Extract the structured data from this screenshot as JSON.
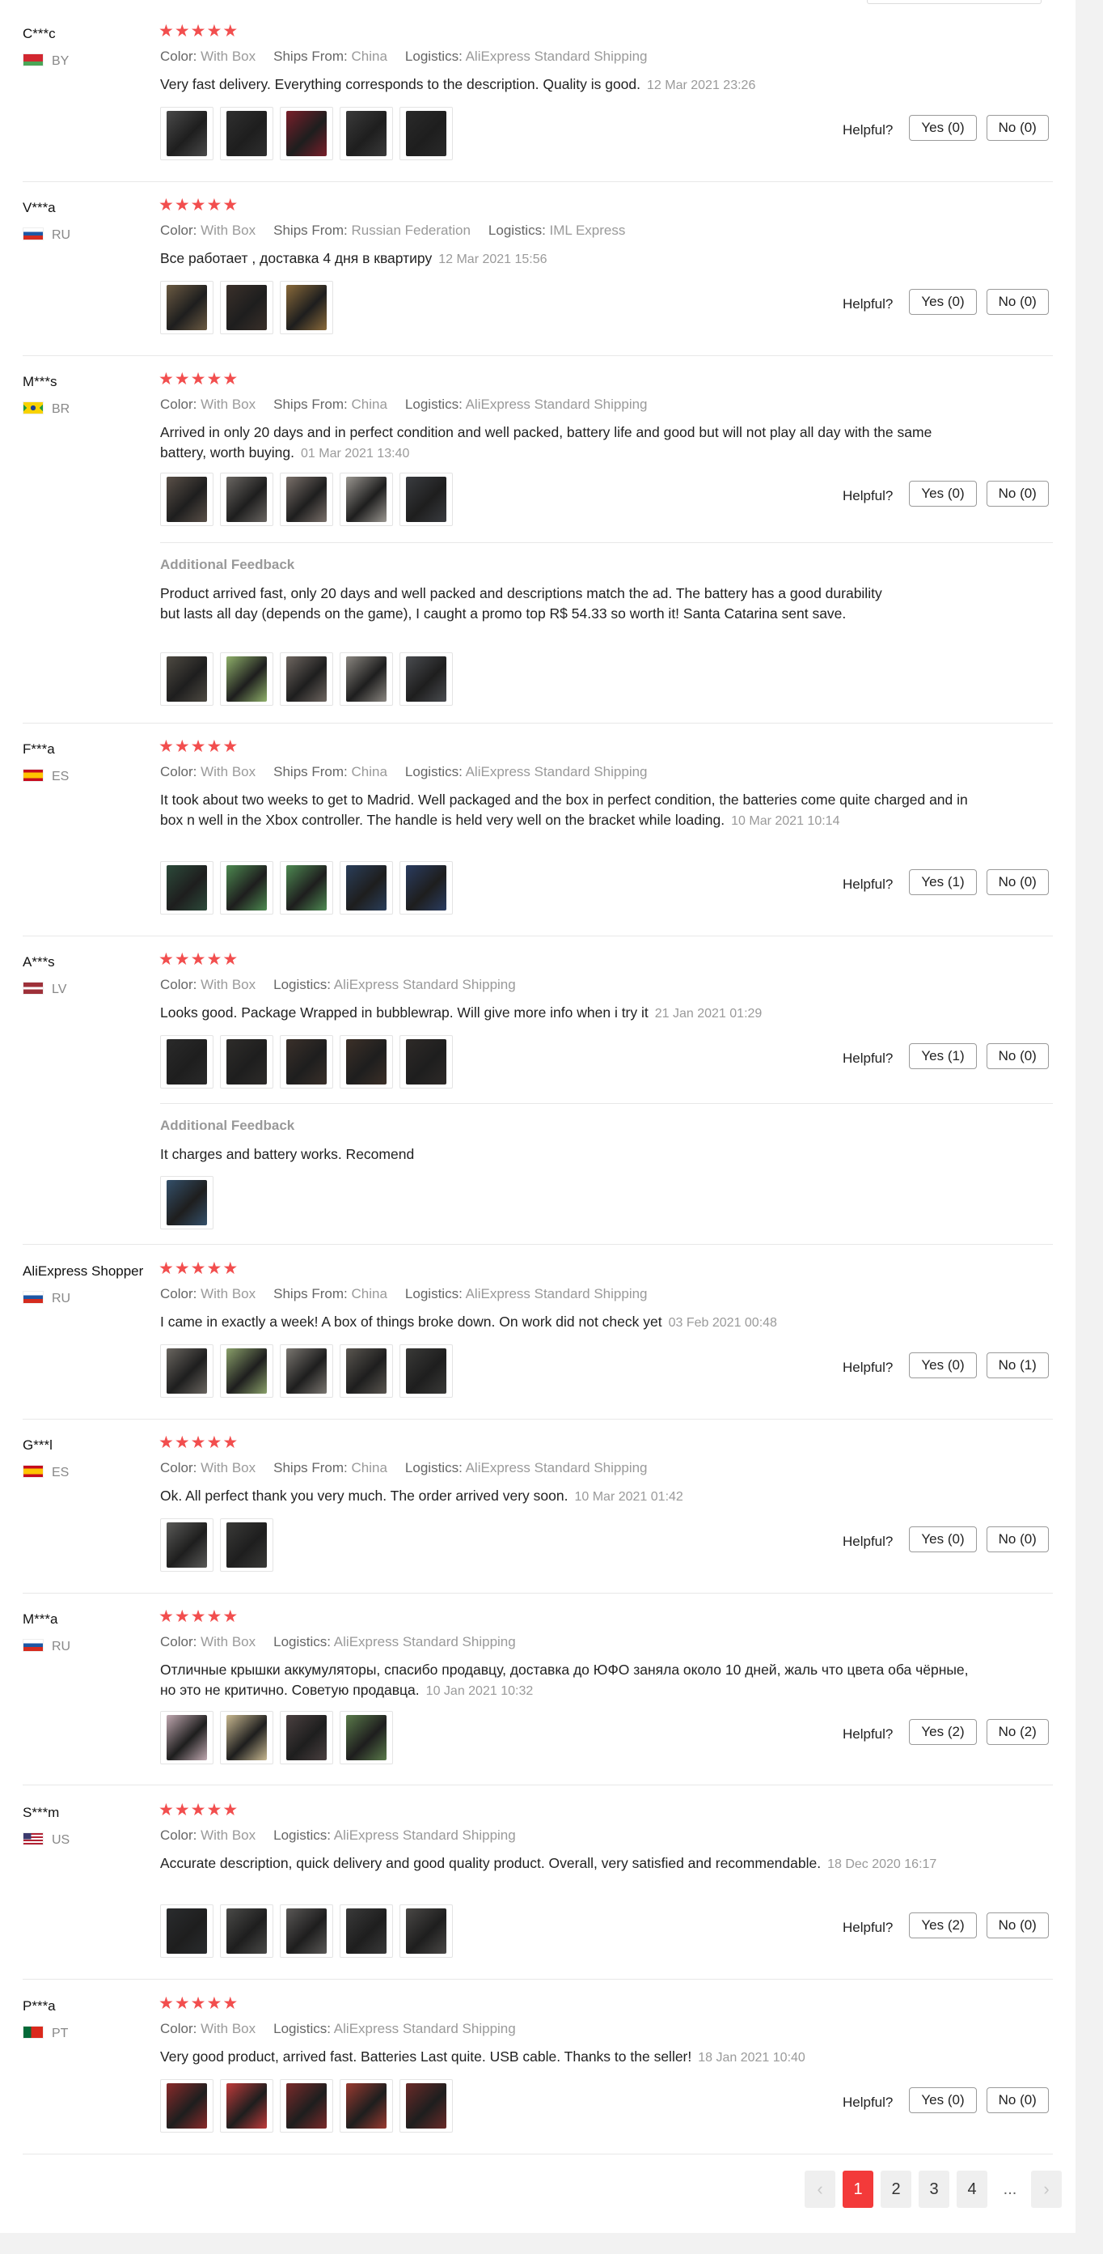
{
  "helpful_label": "Helpful?",
  "additional_feedback_label": "Additional Feedback",
  "labels": {
    "color": "Color:",
    "ships_from": "Ships From:",
    "logistics": "Logistics:"
  },
  "star_glyph": "★",
  "reviews": [
    {
      "user": "C***c",
      "country": "BY",
      "flag": "by",
      "stars": 5,
      "color": "With Box",
      "ships_from": "China",
      "logistics": "AliExpress Standard Shipping",
      "text": "Very fast delivery. Everything corresponds to the description. Quality is good.",
      "date": "12 Mar 2021 23:26",
      "photos": [
        "#4a4a4a",
        "#2f2f2f",
        "#7a1f2a",
        "#3a3a3a",
        "#2a2a2a"
      ],
      "yes": "Yes (0)",
      "no": "No (0)"
    },
    {
      "user": "V***a",
      "country": "RU",
      "flag": "ru",
      "stars": 5,
      "color": "With Box",
      "ships_from": "Russian Federation",
      "logistics": "IML Express",
      "text": "Все работает , доставка 4 дня в квартиру",
      "date": "12 Mar 2021 15:56",
      "photos": [
        "#6b5a42",
        "#3a302a",
        "#8a6a3a"
      ],
      "yes": "Yes (0)",
      "no": "No (0)"
    },
    {
      "user": "M***s",
      "country": "BR",
      "flag": "br",
      "stars": 5,
      "color": "With Box",
      "ships_from": "China",
      "logistics": "AliExpress Standard Shipping",
      "text": "Arrived in only 20 days and in perfect condition and well packed, battery life and good but will not play all day with the same battery, worth buying.",
      "date": "01 Mar 2021 13:40",
      "photos": [
        "#5a5048",
        "#6a6662",
        "#7a706a",
        "#9a9690",
        "#3a3c40"
      ],
      "yes": "Yes (0)",
      "no": "No (0)",
      "additional": {
        "text": "Product arrived fast, only 20 days and well packed and descriptions match the ad. The battery has a good durability but lasts all day (depends on the game), I caught a promo top R$ 54.33 so worth it! Santa Catarina sent save.",
        "photos": [
          "#4e4a42",
          "#8fb06a",
          "#6e6660",
          "#8a8680",
          "#4a4c50"
        ]
      }
    },
    {
      "user": "F***a",
      "country": "ES",
      "flag": "es",
      "stars": 5,
      "color": "With Box",
      "ships_from": "China",
      "logistics": "AliExpress Standard Shipping",
      "text": "It took about two weeks to get to Madrid. Well packaged and the box in perfect condition, the batteries come quite charged and in box n well in the Xbox controller. The handle is held very well on the bracket while loading.",
      "date": "10 Mar 2021 10:14",
      "photos": [
        "#2c4a3a",
        "#4d8a50",
        "#4e8a52",
        "#2a3e5a",
        "#2a3c60"
      ],
      "yes": "Yes (1)",
      "no": "No (0)"
    },
    {
      "user": "A***s",
      "country": "LV",
      "flag": "lv",
      "stars": 5,
      "color": "With Box",
      "logistics": "AliExpress Standard Shipping",
      "text": "Looks good. Package Wrapped in bubblewrap. Will give more info when i try it",
      "date": "21 Jan 2021 01:29",
      "photos": [
        "#2a2a2a",
        "#2e2c2a",
        "#3a302a",
        "#3c3028",
        "#2e2a28"
      ],
      "yes": "Yes (1)",
      "no": "No (0)",
      "additional": {
        "text": "It charges and battery works. Recomend",
        "photos": [
          "#34506a"
        ]
      }
    },
    {
      "user": "AliExpress Shopper",
      "country": "RU",
      "flag": "ru",
      "stars": 5,
      "color": "With Box",
      "ships_from": "China",
      "logistics": "AliExpress Standard Shipping",
      "text": "I came in exactly a week! A box of things broke down. On work did not check yet",
      "date": "03 Feb 2021 00:48",
      "photos": [
        "#6a6660",
        "#8aa06a",
        "#7a7670",
        "#5a5650",
        "#3a3a38"
      ],
      "yes": "Yes (0)",
      "no": "No (1)"
    },
    {
      "user": "G***l",
      "country": "ES",
      "flag": "es",
      "stars": 5,
      "color": "With Box",
      "ships_from": "China",
      "logistics": "AliExpress Standard Shipping",
      "text": "Ok. All perfect thank you very much. The order arrived very soon.",
      "date": "10 Mar 2021 01:42",
      "photos": [
        "#5a5a58",
        "#3a3a38"
      ],
      "yes": "Yes (0)",
      "no": "No (0)"
    },
    {
      "user": "M***a",
      "country": "RU",
      "flag": "ru",
      "stars": 5,
      "color": "With Box",
      "logistics": "AliExpress Standard Shipping",
      "text": "Отличные крышки аккумуляторы, спасибо продавцу, доставка до ЮФО заняла около 10 дней, жаль что цвета оба чёрные, но это не критично. Советую продавца.",
      "date": "10 Jan 2021 10:32",
      "photos": [
        "#c0a8b0",
        "#c8b890",
        "#4a4040",
        "#5a7a4a"
      ],
      "yes": "Yes (2)",
      "no": "No (2)"
    },
    {
      "user": "S***m",
      "country": "US",
      "flag": "us",
      "stars": 5,
      "color": "With Box",
      "logistics": "AliExpress Standard Shipping",
      "text": "Accurate description, quick delivery and good quality product. Overall, very satisfied and recommendable.",
      "date": "18 Dec 2020 16:17",
      "photos": [
        "#2a2c2e",
        "#4a4a48",
        "#5a5856",
        "#3a3a3a",
        "#4a4846"
      ],
      "yes": "Yes (2)",
      "no": "No (0)"
    },
    {
      "user": "P***a",
      "country": "PT",
      "flag": "pt",
      "stars": 5,
      "color": "With Box",
      "logistics": "AliExpress Standard Shipping",
      "text": "Very good product, arrived fast. Batteries Last quite. USB cable. Thanks to the seller!",
      "date": "18 Jan 2021 10:40",
      "photos": [
        "#8a2a2a",
        "#c03a3a",
        "#7a2a2a",
        "#9a3a30",
        "#6a2a28"
      ],
      "yes": "Yes (0)",
      "no": "No (0)"
    }
  ],
  "pagination": {
    "prev_icon": "‹",
    "next_icon": "›",
    "pages": [
      "1",
      "2",
      "3",
      "4"
    ],
    "current": "1",
    "ellipsis": "..."
  },
  "colors": {
    "accent": "#f33a3a",
    "star": "#f24e4e",
    "muted": "#999999"
  }
}
